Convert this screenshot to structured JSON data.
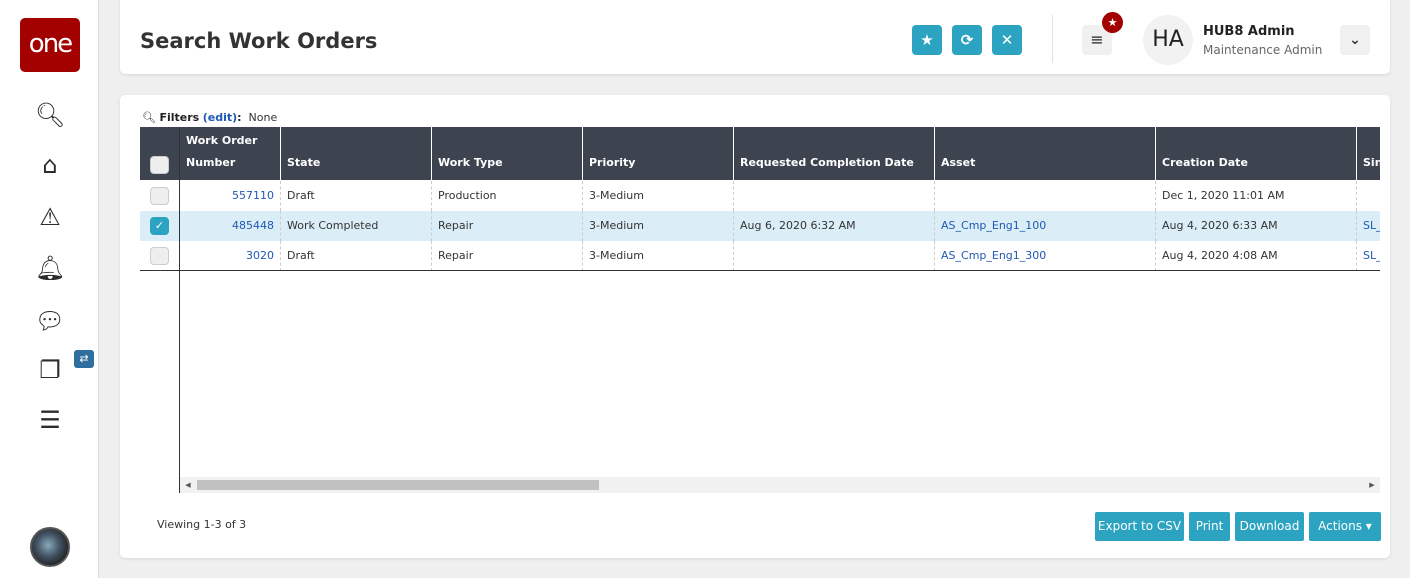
{
  "sidebar": {
    "logo": "one",
    "items": [
      "search",
      "home",
      "alerts",
      "notifications",
      "messages",
      "windows",
      "menu"
    ]
  },
  "header": {
    "title": "Search Work Orders",
    "user_initials": "HA",
    "user_name": "HUB8 Admin",
    "user_role": "Maintenance Admin"
  },
  "filters": {
    "label": "Filters",
    "edit": "(edit)",
    "colon": ":",
    "value": "None"
  },
  "table": {
    "columns": [
      "Work Order Number",
      "State",
      "Work Type",
      "Priority",
      "Requested Completion Date",
      "Asset",
      "Creation Date",
      "Sin"
    ],
    "rows": [
      {
        "selected": false,
        "cells": [
          "557110",
          "Draft",
          "Production",
          "3-Medium",
          "",
          "",
          "Dec 1, 2020 11:01 AM",
          ""
        ]
      },
      {
        "selected": true,
        "cells": [
          "485448",
          "Work Completed",
          "Repair",
          "3-Medium",
          "Aug 6, 2020 6:32 AM",
          "AS_Cmp_Eng1_100",
          "Aug 4, 2020 6:33 AM",
          "SL_"
        ]
      },
      {
        "selected": false,
        "cells": [
          "3020",
          "Draft",
          "Repair",
          "3-Medium",
          "",
          "AS_Cmp_Eng1_300",
          "Aug 4, 2020 4:08 AM",
          "SL_"
        ]
      }
    ]
  },
  "footer": {
    "viewing": "Viewing 1-3 of 3",
    "export": "Export to CSV",
    "print": "Print",
    "download": "Download",
    "actions": "Actions ▾"
  },
  "colors": {
    "accent": "#2ba3c1",
    "brand": "#a30000",
    "header_bg": "#3d4450",
    "link": "#1f58b5"
  }
}
